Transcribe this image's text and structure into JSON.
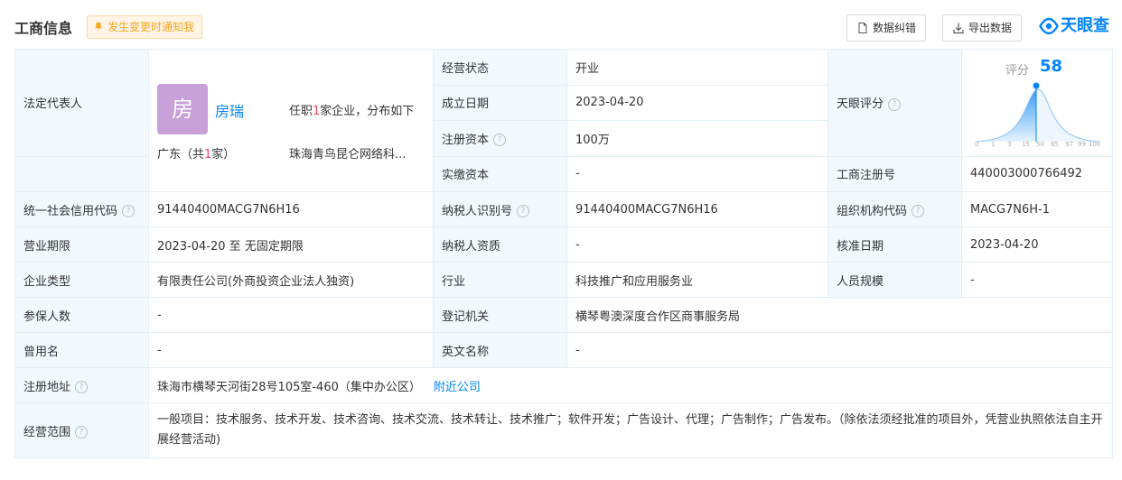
{
  "header": {
    "title": "工商信息",
    "notify_label": "发生变更时通知我",
    "correct_label": "数据纠错",
    "export_label": "导出数据",
    "logo_text": "天眼查"
  },
  "legal_rep": {
    "label": "法定代表人",
    "avatar_char": "房",
    "name": "房瑞",
    "position_prefix": "任职",
    "position_count": "1",
    "position_suffix": "家企业，分布如下",
    "region_prefix": "广东（共",
    "region_count": "1",
    "region_suffix": "家）",
    "company_truncated": "珠海青鸟昆仑网络科..."
  },
  "rating": {
    "label": "天眼评分",
    "score_label": "评分",
    "score": "58",
    "ticks": [
      "0",
      "1",
      "3",
      "15",
      "50",
      "85",
      "97",
      "99",
      "100"
    ]
  },
  "rows": {
    "business_status": {
      "label": "经营状态",
      "value": "开业"
    },
    "established": {
      "label": "成立日期",
      "value": "2023-04-20"
    },
    "registered_capital": {
      "label": "注册资本",
      "value": "100万"
    },
    "paid_capital": {
      "label": "实缴资本",
      "value": "-"
    },
    "reg_number": {
      "label": "工商注册号",
      "value": "440003000766492"
    },
    "credit_code": {
      "label": "统一社会信用代码",
      "value": "91440400MACG7N6H16"
    },
    "taxpayer_id": {
      "label": "纳税人识别号",
      "value": "91440400MACG7N6H16"
    },
    "org_code": {
      "label": "组织机构代码",
      "value": "MACG7N6H-1"
    },
    "term": {
      "label": "营业期限",
      "value": "2023-04-20 至 无固定期限"
    },
    "taxpayer_qual": {
      "label": "纳税人资质",
      "value": "-"
    },
    "approval_date": {
      "label": "核准日期",
      "value": "2023-04-20"
    },
    "company_type": {
      "label": "企业类型",
      "value": "有限责任公司(外商投资企业法人独资)"
    },
    "industry": {
      "label": "行业",
      "value": "科技推广和应用服务业"
    },
    "staff_size": {
      "label": "人员规模",
      "value": "-"
    },
    "insured": {
      "label": "参保人数",
      "value": "-"
    },
    "reg_authority": {
      "label": "登记机关",
      "value": "横琴粤澳深度合作区商事服务局"
    },
    "former_name": {
      "label": "曾用名",
      "value": "-"
    },
    "english_name": {
      "label": "英文名称",
      "value": "-"
    },
    "address": {
      "label": "注册地址",
      "value": "珠海市横琴天河街28号105室-460（集中办公区）",
      "nearby": "附近公司"
    },
    "scope": {
      "label": "经营范围",
      "value": "一般项目：技术服务、技术开发、技术咨询、技术交流、技术转让、技术推广；软件开发；广告设计、代理；广告制作；广告发布。（除依法须经批准的项目外，凭营业执照依法自主开展经营活动)"
    }
  },
  "colors": {
    "accent": "#0084ff",
    "label_bg": "#f2f9fc",
    "highlight": "#fd485e"
  }
}
